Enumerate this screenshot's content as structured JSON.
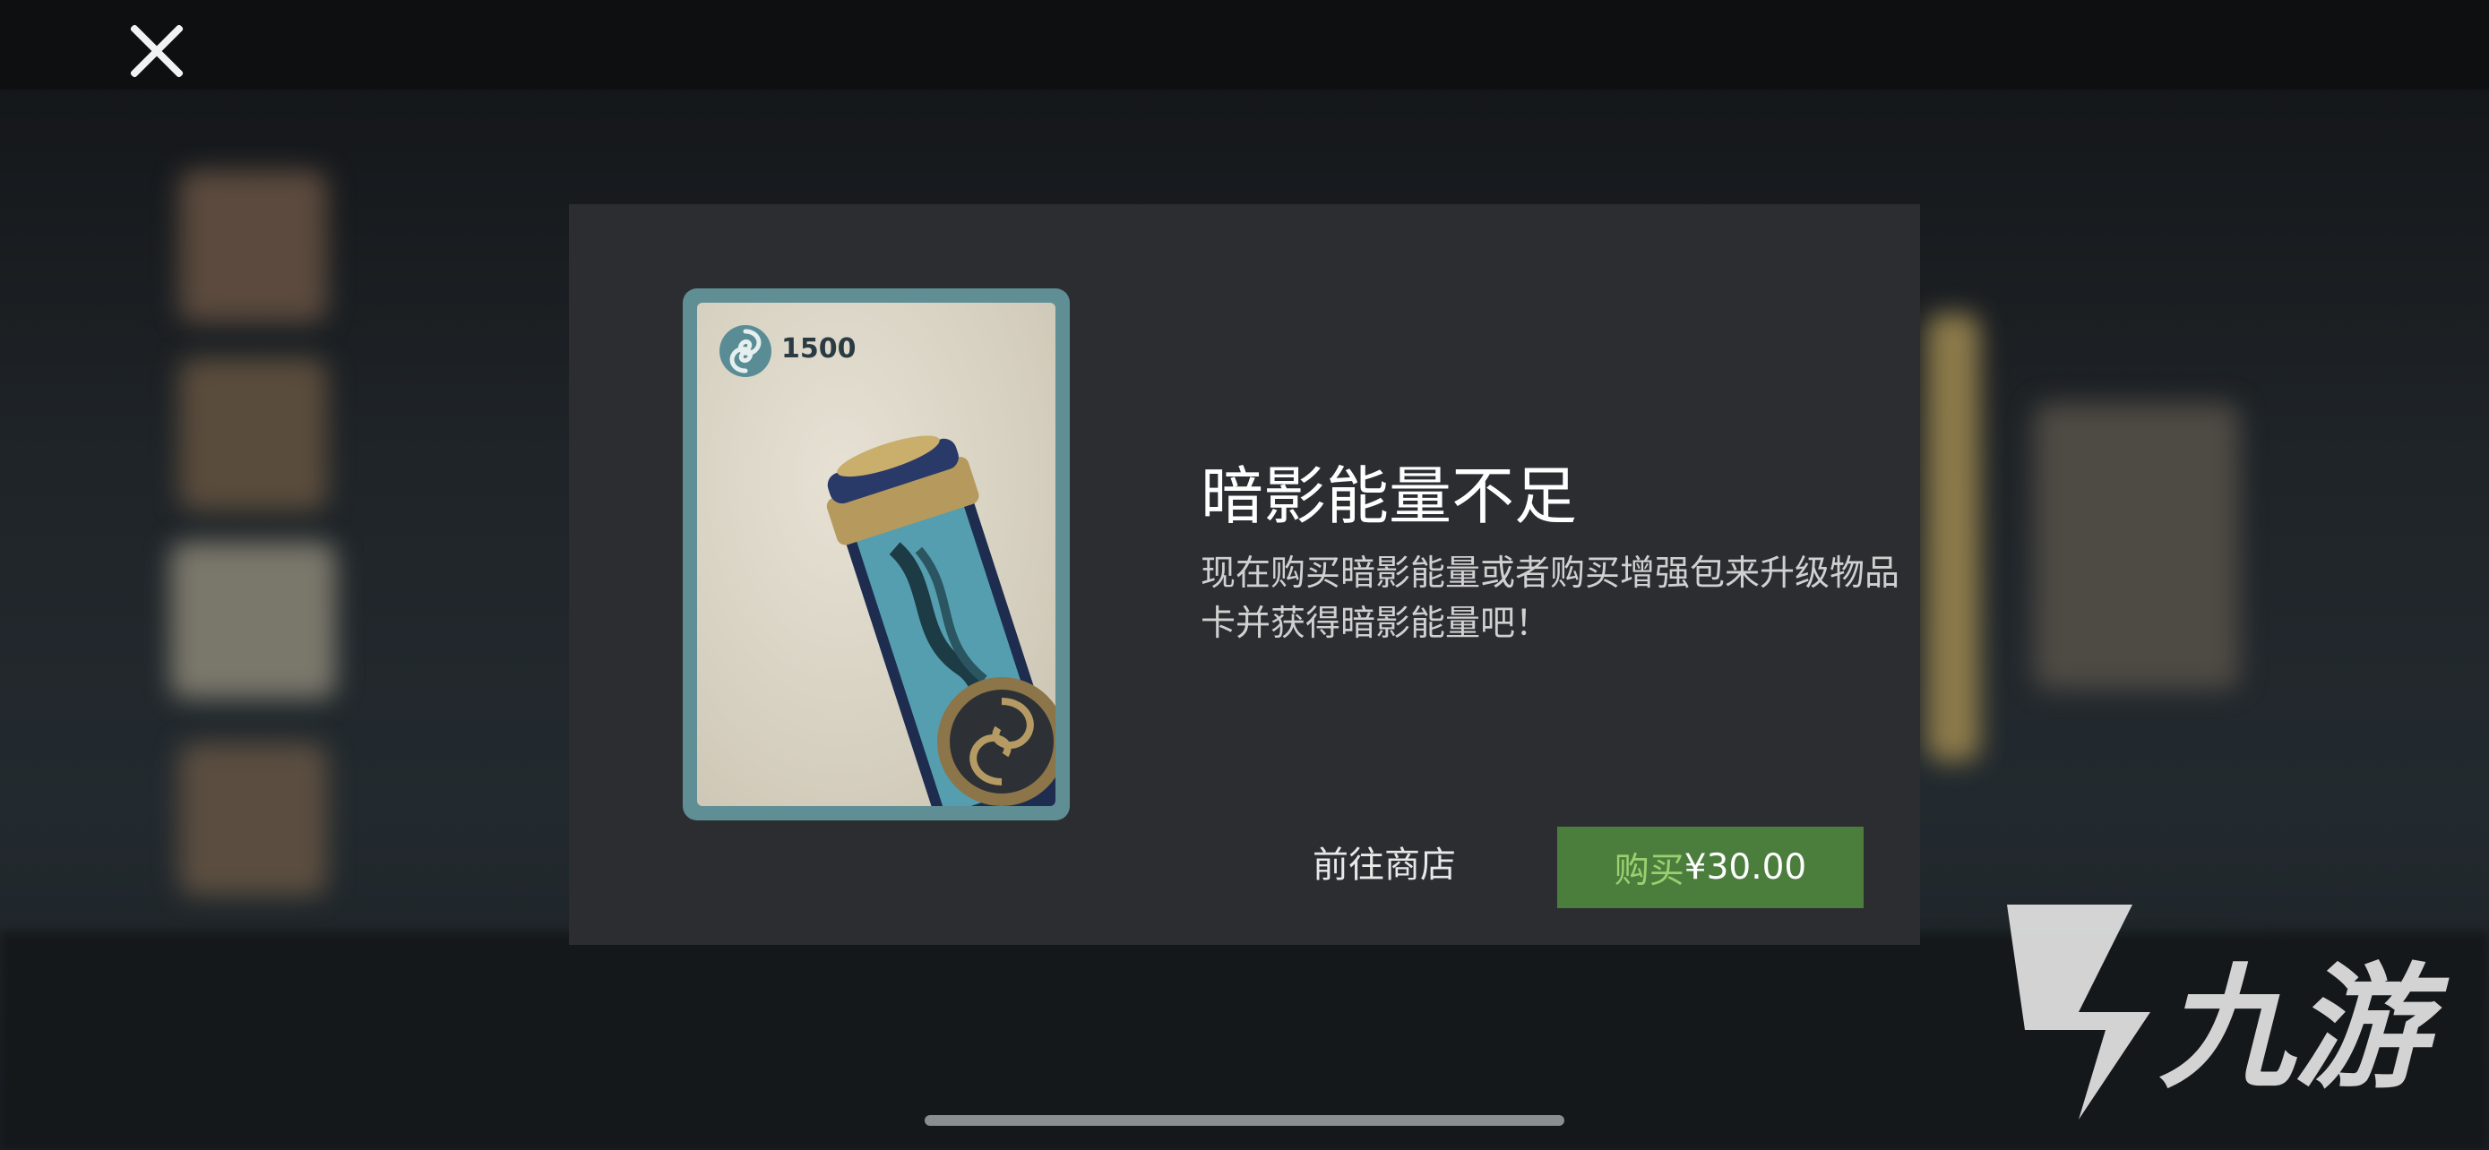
{
  "header": {
    "close_icon": "close-icon"
  },
  "dialog": {
    "title": "暗影能量不足",
    "description": "现在购买暗影能量或者购买增强包来升级物品卡并获得暗影能量吧！",
    "card": {
      "cost": "1500",
      "cost_icon": "shadow-energy-icon",
      "image": "shadow-energy-vial"
    },
    "shop_button_label": "前往商店",
    "buy_button": {
      "label": "购买",
      "price": "¥30.00"
    }
  },
  "watermark": {
    "text": "九游",
    "logo": "jiuyou-logo"
  },
  "colors": {
    "dialog_bg": "#2c2d31",
    "buy_button_bg": "#4b7e3d",
    "buy_label": "#9ad06f",
    "card_frame": "#5f8e95"
  }
}
